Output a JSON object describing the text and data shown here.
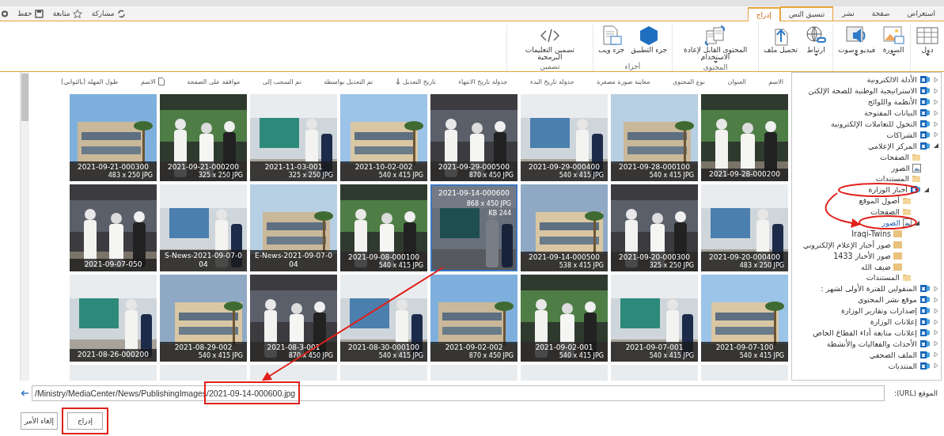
{
  "top_bar": {
    "actions": [
      {
        "label": "مشاركة"
      },
      {
        "label": "متابعة"
      },
      {
        "label": "حفظ"
      }
    ],
    "tabs": [
      {
        "label": "استعراض",
        "selected": false,
        "contextual": false
      },
      {
        "label": "صفحة",
        "selected": false,
        "contextual": false
      },
      {
        "label": "نشر",
        "selected": false,
        "contextual": false
      },
      {
        "label": "تنسيق النص",
        "selected": false,
        "contextual": true
      },
      {
        "label": "إدراج",
        "selected": true,
        "contextual": true
      }
    ]
  },
  "ribbon": {
    "groups": [
      {
        "buttons": [
          {
            "label": "دول",
            "dropdown": true
          }
        ]
      },
      {
        "buttons": [
          {
            "label": "الصورة",
            "dropdown": true
          },
          {
            "label": "فيديو وصوت",
            "dropdown": true
          }
        ]
      },
      {
        "buttons": [
          {
            "label": "ارتباط",
            "dropdown": true
          },
          {
            "label": "تحميل ملف",
            "dropdown": false
          }
        ]
      },
      {
        "label": "المحتوى",
        "buttons": [
          {
            "label": "المحتوى القابل لإعادة الاستخدام",
            "dropdown": true
          }
        ]
      },
      {
        "label": "أجزاء",
        "buttons": [
          {
            "label": "جزء التطبيق",
            "dropdown": false
          },
          {
            "label": "جزء ويب",
            "dropdown": false
          }
        ]
      },
      {
        "label": "تضمين",
        "buttons": [
          {
            "label": "تضمين التعليمات البرمجية",
            "dropdown": false
          }
        ]
      }
    ]
  },
  "columns": [
    {
      "label": "الاسم",
      "kind": "text",
      "sorted": false
    },
    {
      "label": "العنوان",
      "kind": "text",
      "sorted": false
    },
    {
      "label": "نوع المحتوى",
      "kind": "text",
      "sorted": false
    },
    {
      "label": "معاينة صورة مصغرة",
      "kind": "text",
      "sorted": false
    },
    {
      "label": "جدولة تاريخ البدء",
      "kind": "text",
      "sorted": false
    },
    {
      "label": "جدولة تاريخ الانتهاء",
      "kind": "text",
      "sorted": false
    },
    {
      "label": "تاريخ التعديل",
      "kind": "text",
      "sorted": true
    },
    {
      "label": "تم التعديل بواسطة",
      "kind": "text",
      "sorted": false
    },
    {
      "label": "تم السحب إلى",
      "kind": "text",
      "sorted": false
    },
    {
      "label": "موافقة على الصفحة",
      "kind": "text",
      "sorted": false
    },
    {
      "label": "الاسم",
      "kind": "document",
      "sorted": false
    },
    {
      "label": "طول المهلة (بالثواني)",
      "kind": "text",
      "sorted": false
    }
  ],
  "tiles": [
    {
      "name": "2021-09-28-000200",
      "selected": false
    },
    {
      "name": "2021-09-28-000100",
      "size": "540 x 415 JPG",
      "selected": false
    },
    {
      "name": "2021-09-29-000400",
      "size": "540 x 415 JPG",
      "selected": false
    },
    {
      "name": "2021-09-29-000500",
      "size": "870 x 450 JPG",
      "selected": false
    },
    {
      "name": "2021-10-02-002",
      "size": "540 x 415 JPG",
      "selected": false
    },
    {
      "name": "2021-11-03-001",
      "size": "325 x 250 JPG",
      "selected": false
    },
    {
      "name": "2021-09-21-000200",
      "size": "325 x 250 JPG",
      "selected": false
    },
    {
      "name": "2021-09-21-000300",
      "size": "483 x 250 JPG",
      "selected": false
    },
    {
      "name": "2021-09-20-000400",
      "size": "483 x 250 JPG",
      "selected": false
    },
    {
      "name": "2021-09-20-000300",
      "size": "325 x 250 JPG",
      "selected": false
    },
    {
      "name": "2021-09-14-000500",
      "size": "538 x 415 JPG",
      "selected": false
    },
    {
      "name": "2021-09-14-000600",
      "size": "868 x 450 JPG",
      "file_size": "KB 244",
      "selected": true
    },
    {
      "name": "2021-09-08-000100",
      "size": "540 x 415 JPG",
      "selected": false
    },
    {
      "name": "E-News-2021-09-07-004",
      "selected": false
    },
    {
      "name": "S-News-2021-09-07-004",
      "selected": false
    },
    {
      "name": "2021-09-07-050",
      "selected": false
    },
    {
      "name": "2021-09-07-100",
      "size": "540 x 415 JPG",
      "selected": false
    },
    {
      "name": "2021-09-07-001",
      "size": "540 x 415 JPG",
      "selected": false
    },
    {
      "name": "2021-09-02-001",
      "size": "540 x 415 JPG",
      "selected": false
    },
    {
      "name": "2021-09-02-002",
      "size": "870 x 450 JPG",
      "selected": false
    },
    {
      "name": "2021-08-30-000100",
      "size": "540 x 415 JPG",
      "selected": false
    },
    {
      "name": "2021-08-3-001",
      "size": "870 x 450 JPG",
      "selected": false
    },
    {
      "name": "2021-08-29-002",
      "size": "540 x 415 JPG",
      "selected": false
    },
    {
      "name": "2021-08-26-000200",
      "selected": false
    }
  ],
  "tree": [
    {
      "label": "الأدلة الالكترونية",
      "kind": "site",
      "expanded": false,
      "selected": false
    },
    {
      "label": "الاستراتيجية الوطنية للصحة الإلكتن",
      "kind": "site",
      "expanded": false,
      "selected": false
    },
    {
      "label": "الأنظمة واللوائح",
      "kind": "site",
      "expanded": false,
      "selected": false
    },
    {
      "label": "البيانات المفتوحة",
      "kind": "site",
      "expanded": false,
      "selected": false
    },
    {
      "label": "التحول للتعاملات الإلكترونية",
      "kind": "site",
      "expanded": false,
      "selected": false
    },
    {
      "label": "الشراكات",
      "kind": "site",
      "expanded": false,
      "selected": false
    },
    {
      "label": "المركز الإعلامي",
      "kind": "site",
      "expanded": true,
      "selected": false,
      "children": [
        {
          "label": "الصفحات",
          "kind": "folder",
          "selected": false
        },
        {
          "label": "الصور",
          "kind": "library",
          "selected": false
        },
        {
          "label": "المستندات",
          "kind": "folder",
          "selected": false
        },
        {
          "label": "أخبار الوزارة",
          "kind": "site",
          "expanded": true,
          "selected": false,
          "children": [
            {
              "label": "أصول الموقع",
              "kind": "folder",
              "selected": false
            },
            {
              "label": "الصفحات",
              "kind": "folder",
              "selected": false
            },
            {
              "label": "الصور",
              "kind": "library",
              "expanded": true,
              "selected": true,
              "children": [
                {
                  "label": "Iraqi-Twins",
                  "kind": "plain",
                  "selected": false
                },
                {
                  "label": "صور أخبار الإعلام الإلكتروني",
                  "kind": "plain",
                  "selected": false
                },
                {
                  "label": "صور الأخبار 1433",
                  "kind": "plain",
                  "selected": false
                },
                {
                  "label": "ضيف الله",
                  "kind": "plain",
                  "selected": false
                }
              ]
            },
            {
              "label": "المستندات",
              "kind": "folder",
              "selected": false
            }
          ]
        }
      ]
    },
    {
      "label": "المنقولين للفترة الأولى لشهر :",
      "kind": "site",
      "expanded": false,
      "selected": false
    },
    {
      "label": "موقع نشر المحتوى",
      "kind": "site",
      "expanded": false,
      "selected": false
    },
    {
      "label": "إصدارات وتقارير الوزارة",
      "kind": "site",
      "expanded": false,
      "selected": false
    },
    {
      "label": "إعلانات الوزارة",
      "kind": "site",
      "expanded": false,
      "selected": false
    },
    {
      "label": "إعلانات متابعة أداء القطاع الخاص",
      "kind": "site",
      "expanded": false,
      "selected": false
    },
    {
      "label": "الأحداث والفعاليات والأنشطة",
      "kind": "site",
      "expanded": false,
      "selected": false
    },
    {
      "label": "الملف الصحفي",
      "kind": "site",
      "expanded": false,
      "selected": false
    },
    {
      "label": "المنتديات",
      "kind": "site",
      "expanded": false,
      "selected": false
    }
  ],
  "url": {
    "label": "الموقع (URL):",
    "value": "/Ministry/MediaCenter/News/PublishingImages/2021-09-14-000600.jpg"
  },
  "buttons": [
    {
      "label": "إدراج"
    },
    {
      "label": "إلغاء الأمر"
    }
  ]
}
